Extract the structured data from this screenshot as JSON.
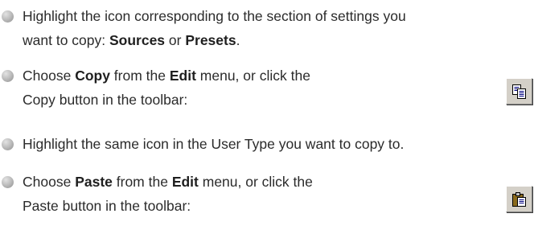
{
  "steps": [
    {
      "line1": [
        "Highlight the icon corresponding to the section of settings you"
      ],
      "line2": [
        "want to copy: ",
        "Sources",
        " or ",
        "Presets",
        "."
      ]
    },
    {
      "line1": [
        "Choose ",
        "Copy",
        " from the ",
        "Edit",
        " menu, or click the"
      ],
      "line2": [
        "Copy button in the toolbar:"
      ],
      "button_icon": "copy-icon"
    },
    {
      "line1": [
        "Highlight the same icon in the User Type you want to copy to."
      ]
    },
    {
      "line1": [
        "Choose ",
        "Paste",
        " from the ",
        "Edit",
        " menu, or click the"
      ],
      "line2": [
        "Paste button in the toolbar:"
      ],
      "button_icon": "paste-icon"
    }
  ]
}
